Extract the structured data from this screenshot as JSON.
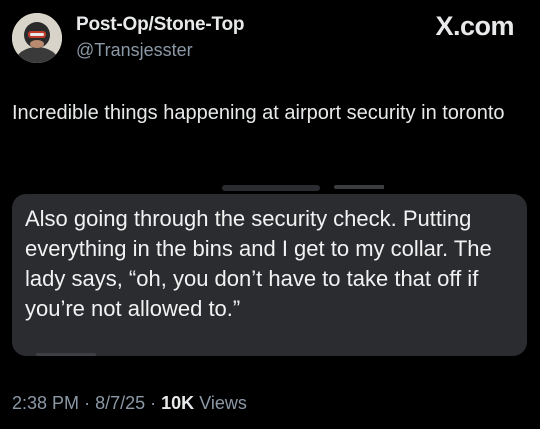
{
  "header": {
    "display_name": "Post-Op/Stone-Top",
    "handle": "@Transjesster",
    "brand": "X.com",
    "avatar_icon": "profile-photo-icon"
  },
  "tweet": {
    "text": "Incredible things happening at airport security in toronto"
  },
  "quoted_message": {
    "text": "Also going through the security check. Putting everything in the bins and I get to my collar. The lady says, “oh, you don’t have to take that off if you’re not allowed to.”"
  },
  "meta": {
    "time": "2:38 PM",
    "separator": "·",
    "date": "8/7/25",
    "views_count": "10K",
    "views_label": "Views"
  },
  "colors": {
    "background": "#000000",
    "text": "#e7e9ea",
    "muted": "#8b98a5",
    "bubble": "#2b2c30"
  }
}
